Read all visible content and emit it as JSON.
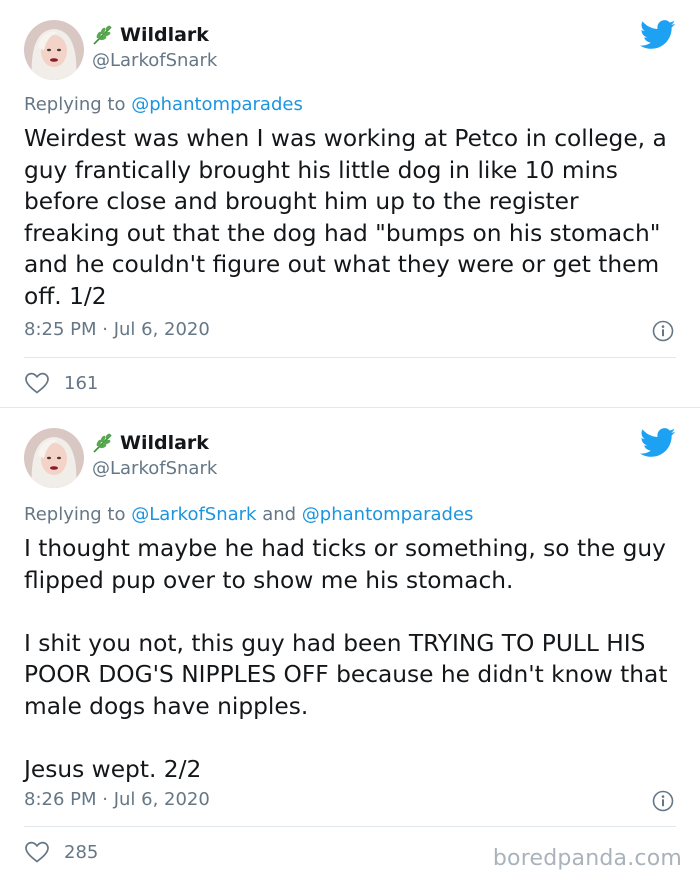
{
  "tweets": [
    {
      "display_name": "Wildlark",
      "handle": "@LarkofSnark",
      "reply_prefix": "Replying to ",
      "reply_mentions": [
        "@phantomparades"
      ],
      "reply_joiner": "",
      "text": [
        "Weirdest was when I was working at Petco in college, a guy frantically brought his little dog in like 10 mins before close and brought him up to the register freaking out that the dog had \"bumps on his stomach\" and he couldn't figure out what they were or get them off. 1/2"
      ],
      "timestamp": "8:25 PM · Jul 6, 2020",
      "likes": "161"
    },
    {
      "display_name": "Wildlark",
      "handle": "@LarkofSnark",
      "reply_prefix": "Replying to ",
      "reply_mentions": [
        "@LarkofSnark",
        "@phantomparades"
      ],
      "reply_joiner": " and ",
      "text": [
        "I thought maybe he had ticks or something, so the guy flipped pup over to show me his stomach.",
        "I shit you not, this guy had been TRYING TO PULL HIS POOR DOG'S NIPPLES OFF because he didn't know that male dogs have nipples.",
        "Jesus wept. 2/2"
      ],
      "timestamp": "8:26 PM · Jul 6, 2020",
      "likes": "285"
    }
  ],
  "watermark": "boredpanda.com",
  "colors": {
    "twitter_blue": "#1da1f2",
    "mention_blue": "#1b95e0",
    "secondary_text": "#657786",
    "divider": "#e1e8ed"
  },
  "icons": [
    "sprig-icon",
    "twitter-bird-icon",
    "info-icon",
    "heart-icon"
  ]
}
